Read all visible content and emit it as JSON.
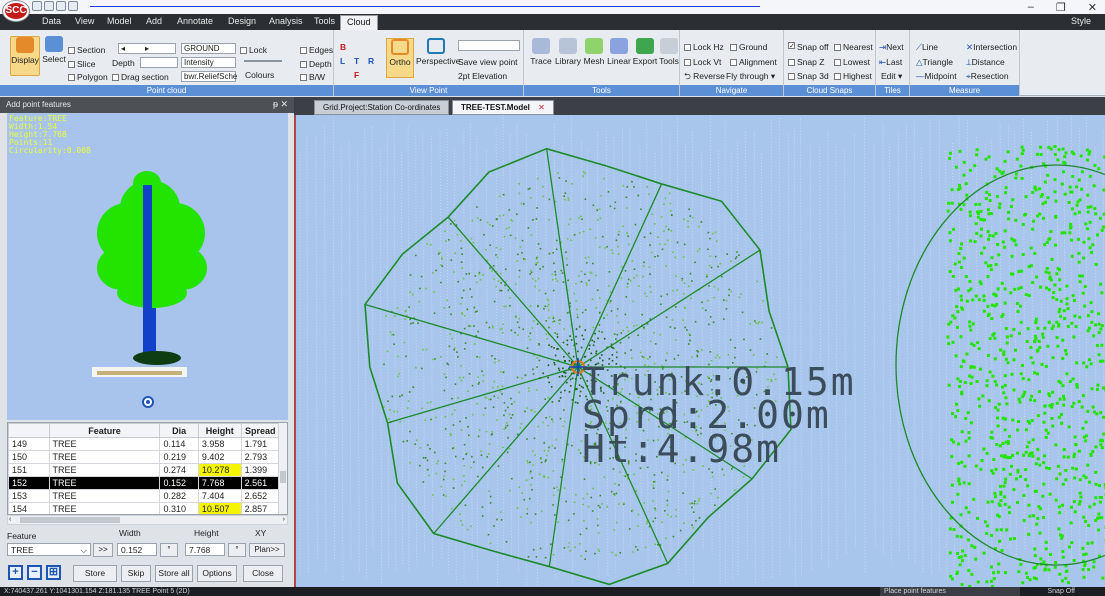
{
  "app": {
    "logo_text": "SCC"
  },
  "window": {
    "minimize": "–",
    "maximize": "❐",
    "close": "✕"
  },
  "menu": {
    "tabs": [
      "Data",
      "View",
      "Model",
      "Add",
      "Annotate",
      "Design",
      "Analysis",
      "Tools",
      "Cloud"
    ],
    "active": "Cloud",
    "style_label": "Style"
  },
  "ribbon": {
    "point_cloud": {
      "label": "Point cloud",
      "display": "Display",
      "select": "Select",
      "section": "Section",
      "slice": "Slice",
      "polygon": "Polygon",
      "depth_label": "Depth",
      "drag_section": "Drag section",
      "ground_value": "GROUND",
      "intensity_value": "Intensity",
      "scheme_value": "bwr.ReliefSche",
      "lock": "Lock",
      "colours": "Colours",
      "edges": "Edges",
      "depth": "Depth",
      "bw": "B/W"
    },
    "view_point": {
      "label": "View Point",
      "ortho": "Ortho",
      "perspective": "Perspective",
      "save_view_point": "Save view point",
      "elevation": "2pt Elevation",
      "cube_letters": [
        "B",
        "L",
        "T",
        "R",
        "F"
      ]
    },
    "tools": {
      "label": "Tools",
      "items": [
        "Trace",
        "Library",
        "Mesh",
        "Linear",
        "Export",
        "Tools"
      ]
    },
    "navigate": {
      "label": "Navigate",
      "lock_hz": "Lock Hz",
      "ground": "Ground",
      "lock_vt": "Lock Vt",
      "alignment": "Alignment",
      "reverse": "Reverse",
      "fly_through": "Fly through"
    },
    "cloud_snaps": {
      "label": "Cloud Snaps",
      "snap_off": "Snap off",
      "nearest": "Nearest",
      "snap_z": "Snap Z",
      "lowest": "Lowest",
      "snap_3d": "Snap 3d",
      "highest": "Highest"
    },
    "tiles": {
      "label": "Tiles",
      "next": "Next",
      "last": "Last",
      "edit": "Edit"
    },
    "measure": {
      "label": "Measure",
      "line": "Line",
      "intersection": "Intersection",
      "triangle": "Triangle",
      "distance": "Distance",
      "midpoint": "Midpoint",
      "resection": "Resection"
    }
  },
  "left_panel": {
    "title": "Add point features",
    "info_lines": [
      "Feature:TREE",
      "Width:1.54",
      "Height:7.768",
      "Points:11",
      "Circularity:0.008"
    ],
    "table": {
      "headers": [
        "",
        "Feature",
        "Dia",
        "Height",
        "Spread"
      ],
      "rows": [
        {
          "id": "149",
          "feature": "TREE",
          "dia": "0.114",
          "height": "3.958",
          "spread": "1.791",
          "hi": false,
          "sel": false
        },
        {
          "id": "150",
          "feature": "TREE",
          "dia": "0.219",
          "height": "9.402",
          "spread": "2.793",
          "hi": false,
          "sel": false
        },
        {
          "id": "151",
          "feature": "TREE",
          "dia": "0.274",
          "height": "10.278",
          "spread": "1.399",
          "hi": true,
          "sel": false
        },
        {
          "id": "152",
          "feature": "TREE",
          "dia": "0.152",
          "height": "7.768",
          "spread": "2.561",
          "hi": false,
          "sel": true
        },
        {
          "id": "153",
          "feature": "TREE",
          "dia": "0.282",
          "height": "7.404",
          "spread": "2.652",
          "hi": false,
          "sel": false
        },
        {
          "id": "154",
          "feature": "TREE",
          "dia": "0.310",
          "height": "10.507",
          "spread": "2.857",
          "hi": true,
          "sel": false
        }
      ]
    },
    "form": {
      "feature_label": "Feature",
      "width_label": "Width",
      "height_label": "Height",
      "xy_label": "XY",
      "feature_value": "TREE",
      "width_value": "0.152",
      "height_value": "7.768",
      "chev": ">>",
      "plan": "Plan>>"
    },
    "actions": {
      "store": "Store",
      "skip": "Skip",
      "store_all": "Store all",
      "options": "Options",
      "close": "Close"
    }
  },
  "doc_tabs": [
    {
      "label": "Grid.Project:Station Co-ordinates",
      "active": false
    },
    {
      "label": "TREE-TEST.Model",
      "active": true
    }
  ],
  "viewport": {
    "trunk": "Trunk:0.15m",
    "spread": "Sprd:2.00m",
    "height": "Ht:4.98m"
  },
  "status": {
    "coords": "X:740437.261 Y:1041301.154 Z:181.135  TREE  Point 5  (2D)",
    "mode": "Place point features",
    "snap": "Snap Off"
  },
  "colors": {
    "menu_bg": "#2b2e33",
    "group_bar": "#5b8fd6",
    "canopy": "#22e400",
    "trunk": "#1141c8",
    "crown_outline": "#1d8a2a",
    "viewport_bg": "#a8c6ec"
  }
}
